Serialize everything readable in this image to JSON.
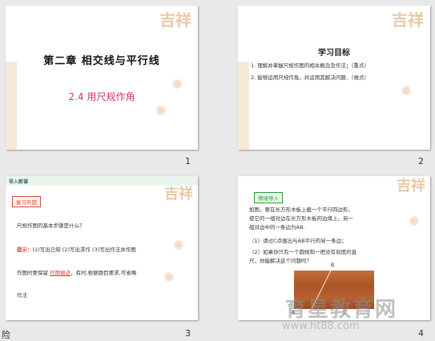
{
  "slides": [
    {
      "number": "1",
      "title": "第二章  相交线与平行线",
      "subtitle": "2.4  用尺规作角"
    },
    {
      "number": "2",
      "heading": "学习目标",
      "objectives": [
        "1. 理解并掌握尺规作图的相关概念及作法；（重点）",
        "2. 能够运用尺规作角，并运用其解决问题．（难点）"
      ]
    },
    {
      "number": "3",
      "tag": "导入新课",
      "review_label": "复习巩固",
      "question": "尺规作图的基本步骤是什么？",
      "hint_label": "提示：",
      "hint": "(1)写出已知 (2)写出求作 (3)写出作法并作图",
      "note_prefix": "作图时要保留",
      "note_link": "作图痕迹",
      "note_suffix": "，有时,根据题目要求,可省略",
      "note_end": "作法",
      "edge_text": "险"
    },
    {
      "number": "4",
      "intro_label": "情境导入",
      "lines": [
        "如图，要在长方形木板上截一个平行四边形，",
        "使它的一组对边在长方形木板的边缘上，另一",
        "组对边中的一条边为AB.",
        "（1）请过C点画出与AB平行的另一条边；",
        "（2）如果你只有一个圆规和一把没有刻度的直",
        "     尺，你能解决这个问题吗？"
      ],
      "figure_labels": [
        "B",
        "A",
        "C"
      ]
    }
  ],
  "watermark": {
    "site": "育星教育网",
    "url": "www.ht88.com"
  },
  "colors": {
    "subtitle": "#d0307a",
    "decoration": "#e9c9a8",
    "wood": "#b5612f"
  }
}
